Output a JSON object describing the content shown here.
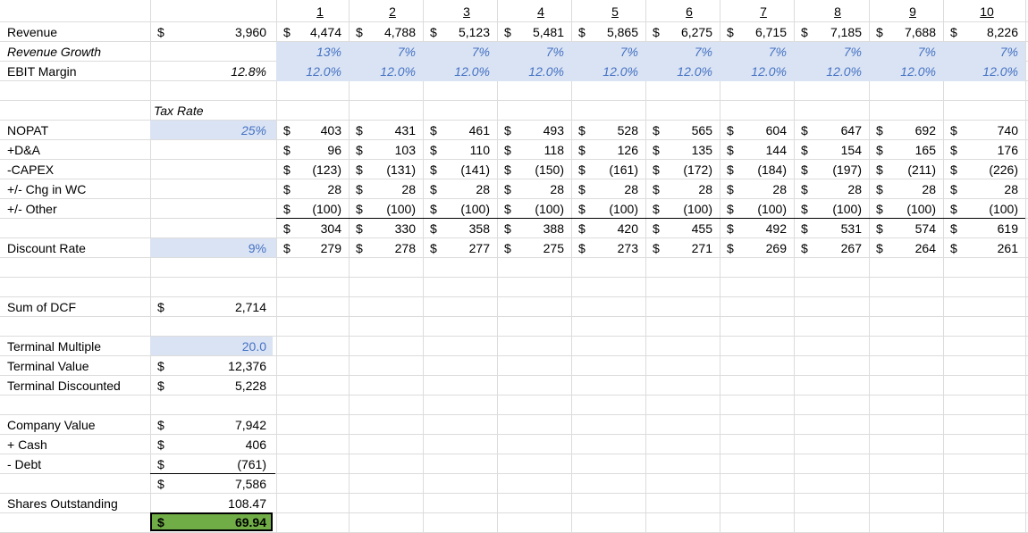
{
  "periods": [
    "1",
    "2",
    "3",
    "4",
    "5",
    "6",
    "7",
    "8",
    "9",
    "10"
  ],
  "dollar": "$",
  "rows": {
    "revenue": {
      "label": "Revenue",
      "base": "3,960",
      "values": [
        "4,474",
        "4,788",
        "5,123",
        "5,481",
        "5,865",
        "6,275",
        "6,715",
        "7,185",
        "7,688",
        "8,226"
      ]
    },
    "revenue_growth": {
      "label": "Revenue Growth",
      "values": [
        "13%",
        "7%",
        "7%",
        "7%",
        "7%",
        "7%",
        "7%",
        "7%",
        "7%",
        "7%"
      ]
    },
    "ebit_margin": {
      "label": "EBIT Margin",
      "base": "12.8%",
      "values": [
        "12.0%",
        "12.0%",
        "12.0%",
        "12.0%",
        "12.0%",
        "12.0%",
        "12.0%",
        "12.0%",
        "12.0%",
        "12.0%"
      ]
    },
    "nopat": {
      "label": "NOPAT",
      "values": [
        "403",
        "431",
        "461",
        "493",
        "528",
        "565",
        "604",
        "647",
        "692",
        "740"
      ]
    },
    "da": {
      "label": "+D&A",
      "values": [
        "96",
        "103",
        "110",
        "118",
        "126",
        "135",
        "144",
        "154",
        "165",
        "176"
      ]
    },
    "capex": {
      "label": "-CAPEX",
      "values": [
        "(123)",
        "(131)",
        "(141)",
        "(150)",
        "(161)",
        "(172)",
        "(184)",
        "(197)",
        "(211)",
        "(226)"
      ]
    },
    "wc": {
      "label": "+/- Chg in WC",
      "values": [
        "28",
        "28",
        "28",
        "28",
        "28",
        "28",
        "28",
        "28",
        "28",
        "28"
      ]
    },
    "other": {
      "label": "+/- Other",
      "values": [
        "(100)",
        "(100)",
        "(100)",
        "(100)",
        "(100)",
        "(100)",
        "(100)",
        "(100)",
        "(100)",
        "(100)"
      ]
    },
    "fcf": {
      "values": [
        "304",
        "330",
        "358",
        "388",
        "420",
        "455",
        "492",
        "531",
        "574",
        "619"
      ]
    },
    "discounted": {
      "label": "Discount Rate",
      "values": [
        "279",
        "278",
        "277",
        "275",
        "273",
        "271",
        "269",
        "267",
        "264",
        "261"
      ]
    }
  },
  "tax_rate": {
    "header": "Tax Rate",
    "value": "25%"
  },
  "discount_rate": {
    "value": "9%"
  },
  "summary": {
    "sum_dcf": {
      "label": "Sum of DCF",
      "value": "2,714"
    },
    "terminal_multiple": {
      "label": "Terminal Multiple",
      "value": "20.0"
    },
    "terminal_value": {
      "label": "Terminal Value",
      "value": "12,376"
    },
    "terminal_discounted": {
      "label": "Terminal Discounted",
      "value": "5,228"
    },
    "company_value": {
      "label": "Company Value",
      "value": "7,942"
    },
    "cash": {
      "label": "+ Cash",
      "value": "406"
    },
    "debt": {
      "label": "- Debt",
      "value": "(761)"
    },
    "equity": {
      "value": "7,586"
    },
    "shares": {
      "label": "Shares Outstanding",
      "value": "108.47"
    },
    "price": {
      "value": "69.94"
    }
  },
  "colors": {
    "input_shade": "#dae3f3",
    "input_text": "#4472c4",
    "result_fill": "#70ad47",
    "gridline": "#dcdcdc"
  }
}
